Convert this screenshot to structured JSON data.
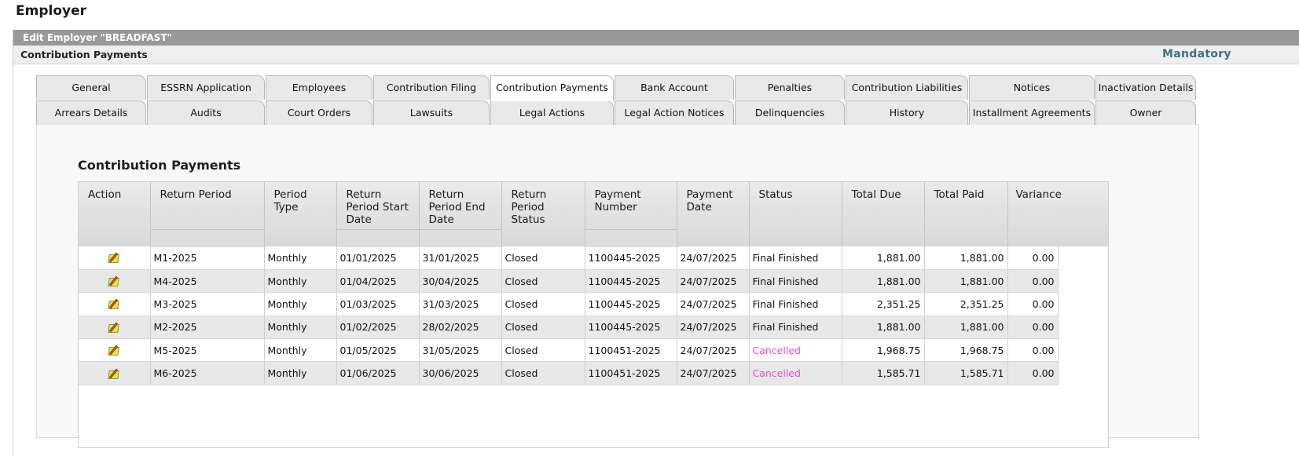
{
  "page_title": "Employer",
  "panel_title": "Edit Employer \"BREADFAST\"",
  "sub_title": "Contribution Payments",
  "mandatory_label": "Mandatory",
  "tabs_row1": [
    "General",
    "ESSRN Application",
    "Employees",
    "Contribution Filing",
    "Contribution Payments",
    "Bank Account",
    "Penalties",
    "Contribution Liabilities",
    "Notices",
    "Inactivation Details"
  ],
  "tabs_row2": [
    "Arrears Details",
    "Audits",
    "Court Orders",
    "Lawsuits",
    "Legal Actions",
    "Legal Action Notices",
    "Delinquencies",
    "History",
    "Installment Agreements",
    "Owner"
  ],
  "active_tab": "Contribution Payments",
  "section_title": "Contribution Payments",
  "columns": [
    "Action",
    "Return Period",
    "Period Type",
    "Return Period Start Date",
    "Return Period End Date",
    "Return Period Status",
    "Payment Number",
    "Payment Date",
    "Status",
    "Total Due",
    "Total Paid",
    "Variance"
  ],
  "rows": [
    {
      "return_period": "M1-2025",
      "period_type": "Monthly",
      "start": "01/01/2025",
      "end": "31/01/2025",
      "rp_status": "Closed",
      "payment_number": "1100445-2025",
      "payment_date": "24/07/2025",
      "status": "Final Finished",
      "total_due": "1,881.00",
      "total_paid": "1,881.00",
      "variance": "0.00"
    },
    {
      "return_period": "M4-2025",
      "period_type": "Monthly",
      "start": "01/04/2025",
      "end": "30/04/2025",
      "rp_status": "Closed",
      "payment_number": "1100445-2025",
      "payment_date": "24/07/2025",
      "status": "Final Finished",
      "total_due": "1,881.00",
      "total_paid": "1,881.00",
      "variance": "0.00"
    },
    {
      "return_period": "M3-2025",
      "period_type": "Monthly",
      "start": "01/03/2025",
      "end": "31/03/2025",
      "rp_status": "Closed",
      "payment_number": "1100445-2025",
      "payment_date": "24/07/2025",
      "status": "Final Finished",
      "total_due": "2,351.25",
      "total_paid": "2,351.25",
      "variance": "0.00"
    },
    {
      "return_period": "M2-2025",
      "period_type": "Monthly",
      "start": "01/02/2025",
      "end": "28/02/2025",
      "rp_status": "Closed",
      "payment_number": "1100445-2025",
      "payment_date": "24/07/2025",
      "status": "Final Finished",
      "total_due": "1,881.00",
      "total_paid": "1,881.00",
      "variance": "0.00"
    },
    {
      "return_period": "M5-2025",
      "period_type": "Monthly",
      "start": "01/05/2025",
      "end": "31/05/2025",
      "rp_status": "Closed",
      "payment_number": "1100451-2025",
      "payment_date": "24/07/2025",
      "status": "Cancelled",
      "total_due": "1,968.75",
      "total_paid": "1,968.75",
      "variance": "0.00"
    },
    {
      "return_period": "M6-2025",
      "period_type": "Monthly",
      "start": "01/06/2025",
      "end": "30/06/2025",
      "rp_status": "Closed",
      "payment_number": "1100451-2025",
      "payment_date": "24/07/2025",
      "status": "Cancelled",
      "total_due": "1,585.71",
      "total_paid": "1,585.71",
      "variance": "0.00"
    }
  ],
  "colors": {
    "header_bar": "#999999",
    "mandatory": "#3d6e8a",
    "cancelled": "#e44fd6",
    "alt_row": "#e8e8e8"
  },
  "action_icon": "edit-icon"
}
